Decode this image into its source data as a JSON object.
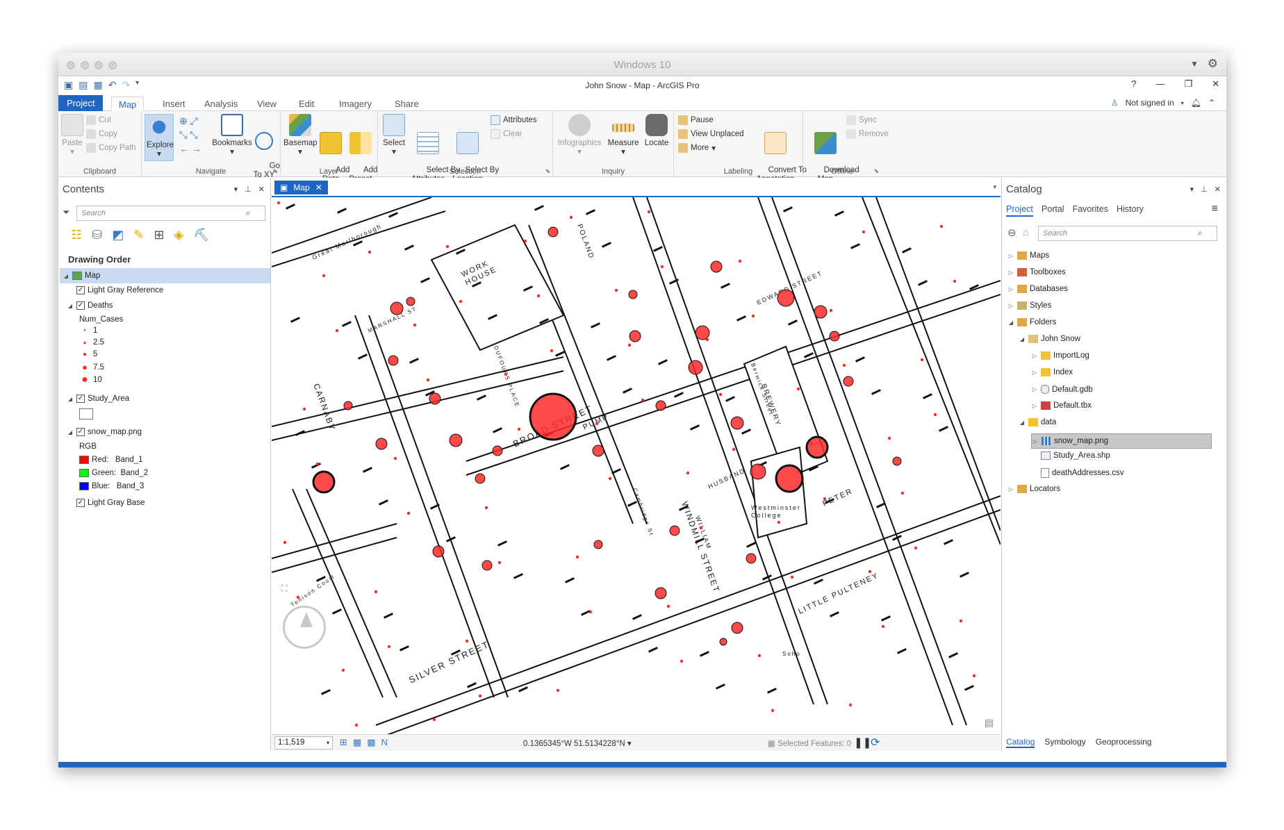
{
  "window": {
    "mac_title": "Windows 10",
    "app_title": "John Snow - Map - ArcGIS Pro"
  },
  "ribbon_tabs": [
    "Project",
    "Map",
    "Insert",
    "Analysis",
    "View",
    "Edit",
    "Imagery",
    "Share"
  ],
  "account": {
    "signin": "Not signed in"
  },
  "clipboard": {
    "paste": "Paste",
    "cut": "Cut",
    "copy": "Copy",
    "copy_path": "Copy Path",
    "label": "Clipboard"
  },
  "navigate": {
    "explore": "Explore",
    "bookmarks": "Bookmarks",
    "goto": "Go\nTo XY",
    "label": "Navigate"
  },
  "layer": {
    "basemap": "Basemap",
    "add_data": "Add\nData",
    "add_preset": "Add\nPreset",
    "label": "Layer"
  },
  "selection": {
    "select": "Select",
    "select_by_attributes": "Select By\nAttributes",
    "select_by_location": "Select By\nLocation",
    "attributes": "Attributes",
    "clear": "Clear",
    "label": "Selection"
  },
  "inquiry": {
    "infographics": "Infographics",
    "measure": "Measure",
    "locate": "Locate",
    "label": "Inquiry"
  },
  "labeling": {
    "pause": "Pause",
    "view_unplaced": "View Unplaced",
    "more": "More",
    "convert": "Convert To\nAnnotation",
    "label": "Labeling"
  },
  "offline": {
    "download_map": "Download\nMap",
    "sync": "Sync",
    "remove": "Remove",
    "label": "Offline"
  },
  "contents": {
    "title": "Contents",
    "search_placeholder": "Search",
    "drawing_order": "Drawing Order",
    "map": "Map",
    "light_gray_reference": "Light Gray Reference",
    "deaths": "Deaths",
    "num_cases": "Num_Cases",
    "classes": [
      "1",
      "2.5",
      "5",
      "7.5",
      "10"
    ],
    "study_area": "Study_Area",
    "snow_map": "snow_map.png",
    "rgb": "RGB",
    "bands": [
      {
        "label": "Red:   Band_1",
        "color": "#ff0000"
      },
      {
        "label": "Green:  Band_2",
        "color": "#00ff00"
      },
      {
        "label": "Blue:   Band_3",
        "color": "#0000ff"
      }
    ],
    "light_gray_base": "Light Gray Base"
  },
  "map_view": {
    "tab": "Map",
    "scale": "1:1,519",
    "coords": "0.1365345°W 51.5134228°N",
    "selected": "Selected Features: 0",
    "death_color": "#ff2a2a"
  },
  "map_labels": {
    "work_house": "WORK\nHOUSE",
    "brewery": "BREWERY",
    "westminster": "Westminster\nCollege",
    "pump": "PUMP",
    "broad_street": "BROAD STREET",
    "marshall": "MARSHALL ST",
    "dufours": "DUFOURS PLACE",
    "great_marlborough": "Great Marlborough",
    "carnaby": "CARNABY",
    "silver": "SILVER STREET",
    "windmill": "WINDMILL STREET",
    "poland": "POLAND",
    "edward": "EDWARD STREET",
    "husband": "HUSBAND",
    "william": "WILLIAM",
    "peter": "PETER",
    "little_pulteney": "LITTLE PULTENEY",
    "cambridge": "Cambridge St",
    "berwick": "Berwick Street",
    "soho": "Soho",
    "tenison": "Tenison Court"
  },
  "catalog": {
    "title": "Catalog",
    "tabs": [
      "Project",
      "Portal",
      "Favorites",
      "History"
    ],
    "search_placeholder": "Search",
    "items": {
      "maps": "Maps",
      "toolboxes": "Toolboxes",
      "databases": "Databases",
      "styles": "Styles",
      "folders": "Folders",
      "john_snow": "John Snow",
      "importlog": "ImportLog",
      "index": "Index",
      "gdb": "Default.gdb",
      "tbx": "Default.tbx",
      "data": "data",
      "snow_map": "snow_map.png",
      "study_area": "Study_Area.shp",
      "deaths_csv": "deathAddresses.csv",
      "locators": "Locators"
    },
    "bottom_tabs": [
      "Catalog",
      "Symbology",
      "Geoprocessing"
    ]
  }
}
